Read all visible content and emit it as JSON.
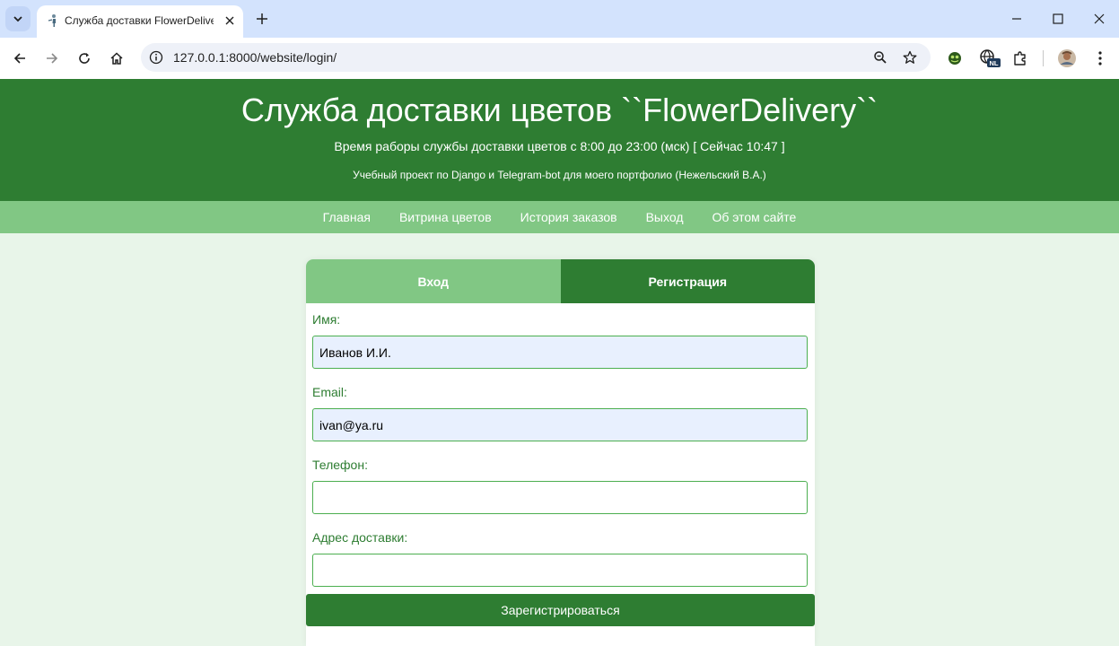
{
  "browser": {
    "tab_title": "Служба доставки FlowerDelivery",
    "url": "127.0.0.1:8000/website/login/",
    "extension_badge": "NL"
  },
  "header": {
    "title": "Служба доставки цветов ``FlowerDelivery``",
    "hours": "Время раборы службы доставки цветов с 8:00 до 23:00 (мск) [ Сейчас 10:47 ]",
    "subtitle": "Учебный проект по Django и Telegram-bot для моего портфолио (Нежельский В.А.)"
  },
  "nav": {
    "items": [
      "Главная",
      "Витрина цветов",
      "История заказов",
      "Выход",
      "Об этом сайте"
    ]
  },
  "auth": {
    "tabs": [
      "Вход",
      "Регистрация"
    ],
    "active_tab": "Регистрация",
    "fields": [
      {
        "label": "Имя:",
        "value": "Иванов И.И."
      },
      {
        "label": "Email:",
        "value": "ivan@ya.ru"
      },
      {
        "label": "Телефон:",
        "value": ""
      },
      {
        "label": "Адрес доставки:",
        "value": ""
      }
    ],
    "submit_label": "Зарегистрироваться"
  },
  "colors": {
    "primary": "#2e7d32",
    "secondary": "#81c784",
    "background": "#e8f5e9",
    "autofill": "#e8f0fe"
  }
}
